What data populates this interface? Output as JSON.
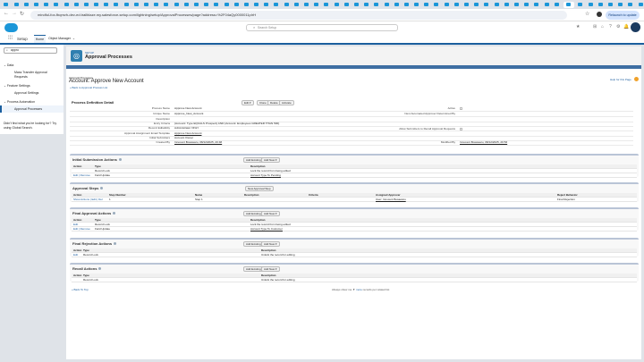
{
  "browser": {
    "url": "mindful-fox-fbqmvh-dev-ed.trailblaze.my.salesforce-setup.com/lightning/setup/ApprovalProcesses/page?address=%2F04aQy0000011pIrH",
    "relaunch": "Relaunch to update"
  },
  "header": {
    "search_placeholder": "Search Setup",
    "app": "Setup",
    "nav": [
      "Home",
      "Object Manager"
    ]
  },
  "sidebar": {
    "search": "appro",
    "groups": [
      {
        "label": "Data",
        "items": [
          "Mass Transfer Approval Requests"
        ]
      },
      {
        "label": "Feature Settings",
        "items": [
          "Approval Settings"
        ]
      },
      {
        "label": "Process Automation",
        "items": [
          "Approval Processes"
        ]
      }
    ],
    "footer": "Didn't find what you're looking for? Try using Global Search."
  },
  "page": {
    "eyebrow": "SETUP",
    "title": "Approval Processes",
    "crumb": "Approval Processes",
    "heading": "Account: Approve New Account",
    "back": "« Back to Approval Process List",
    "help": "Help for this Page"
  },
  "detail": {
    "title": "Process Definition Detail",
    "buttons": [
      "Edit ▾",
      "Clone",
      "Delete",
      "Activate"
    ],
    "fields": [
      {
        "label": "Process Name",
        "value": "Approve New Account"
      },
      {
        "label": "Unique Name",
        "value": "Approve_New_Account"
      },
      {
        "label": "Description",
        "value": ""
      },
      {
        "label": "Entry Criteria",
        "value": "(Account: Type EQUALS Prospect) AND (Account: Employees GREATER THAN 500)"
      },
      {
        "label": "Record Editability",
        "value": "Administrator ONLY"
      },
      {
        "label": "Approval Assignment Email Template",
        "value": "Approve New Account"
      },
      {
        "label": "Initial Submitters",
        "value": "Account Owner"
      },
      {
        "label": "Created By",
        "value": "Innocent Bosawaru, 08/12/2025, 20:48"
      }
    ],
    "right": [
      {
        "label": "Active"
      },
      {
        "label": "Next Automated Approver Determined By",
        "value": ""
      },
      {
        "label": "Allow Submitters to Recall Approval Requests"
      },
      {
        "label": "Modified By",
        "value": "Innocent Bosawaru, 08/12/2025, 20:53"
      }
    ]
  },
  "add_existing": "Add Existing",
  "add_new": "Add New ▾",
  "initial": {
    "title": "Initial Submission Actions",
    "cols": [
      "Action",
      "Type",
      "Description"
    ],
    "rows": [
      {
        "action": "",
        "type": "Record Lock",
        "desc": "Lock the record from being edited"
      },
      {
        "action": "Edit | Remove",
        "type": "Field Update",
        "desc": "Account Type To Pending"
      }
    ]
  },
  "steps": {
    "title": "Approval Steps",
    "button": "New Approval Step",
    "cols": [
      "Action",
      "Step Number",
      "Name",
      "Description",
      "Criteria",
      "Assigned Approver",
      "Reject Behavior"
    ],
    "rows": [
      {
        "action": "Show Actions | Edit | Del",
        "num": "1",
        "name": "Step 1",
        "desc": "",
        "criteria": "",
        "approver": "User: Innocent Bosawaru",
        "reject": "Final Rejection"
      }
    ]
  },
  "final_approval": {
    "title": "Final Approval Actions",
    "cols": [
      "Action",
      "Type",
      "Description"
    ],
    "rows": [
      {
        "action": "Edit",
        "type": "Record Lock",
        "desc": "Lock the record from being edited"
      },
      {
        "action": "Edit | Remove",
        "type": "Field Update",
        "desc": "Account Type To Customer"
      }
    ]
  },
  "final_rejection": {
    "title": "Final Rejection Actions",
    "cols": [
      "Action",
      "Type",
      "Description"
    ],
    "rows": [
      {
        "action": "Edit",
        "type": "Record Lock",
        "desc": "Unlock the record for editing"
      }
    ]
  },
  "recall": {
    "title": "Recall Actions",
    "cols": [
      "Action",
      "Type",
      "Description"
    ],
    "rows": [
      {
        "action": "",
        "type": "Record Lock",
        "desc": "Unlock the record for editing"
      }
    ]
  },
  "footer": {
    "back_top": "« Back To Top",
    "always_pre": "Always show me",
    "more": "more",
    "always_post": "records per related list"
  }
}
